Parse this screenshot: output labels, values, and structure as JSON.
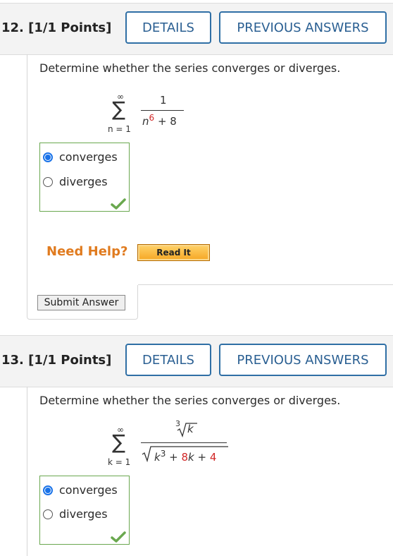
{
  "q12": {
    "title": "12.  [1/1 Points]",
    "details": "DETAILS",
    "previous": "PREVIOUS ANSWERS",
    "prompt": "Determine whether the series converges or diverges.",
    "sum_upper": "∞",
    "sum_lower": "n = 1",
    "numerator": "1",
    "den_var": "n",
    "den_exp": "6",
    "den_rest": "+ 8",
    "choices": [
      "converges",
      "diverges"
    ],
    "selected": 0,
    "need_help": "Need Help?",
    "read_it": "Read It",
    "submit": "Submit Answer"
  },
  "q13": {
    "title": "13.  [1/1 Points]",
    "details": "DETAILS",
    "previous": "PREVIOUS ANSWERS",
    "prompt": "Determine whether the series converges or diverges.",
    "sum_upper": "∞",
    "sum_lower": "k = 1",
    "num_index": "3",
    "num_var": "k",
    "den_var": "k",
    "den_exp": "3",
    "den_plus1": "+",
    "den_coef": "8",
    "den_k": "k",
    "den_plus2": "+",
    "den_const": "4",
    "choices": [
      "converges",
      "diverges"
    ],
    "selected": 0
  },
  "colors": {
    "accent": "#2f6fa5",
    "help": "#e07b1f",
    "correct": "#6aa84f",
    "highlight_red": "#d12727"
  },
  "icons": [
    "sigma-symbol",
    "radical-symbol",
    "checkmark-icon"
  ]
}
